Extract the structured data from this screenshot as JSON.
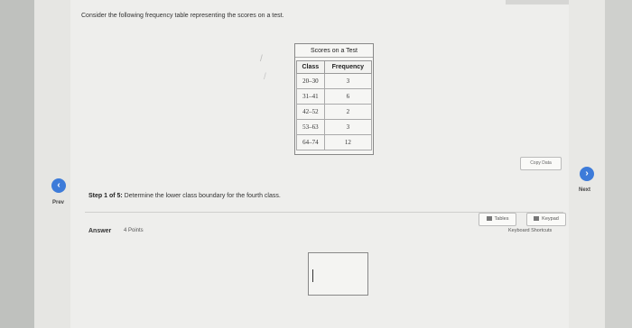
{
  "question": {
    "text": "Consider the following frequency table representing the scores on a test."
  },
  "table": {
    "title": "Scores on a Test",
    "headers": [
      "Class",
      "Frequency"
    ],
    "rows": [
      [
        "20–30",
        "3"
      ],
      [
        "31–41",
        "6"
      ],
      [
        "42–52",
        "2"
      ],
      [
        "53–63",
        "3"
      ],
      [
        "64–74",
        "12"
      ]
    ]
  },
  "nav": {
    "prev_label": "Prev",
    "next_label": "Next",
    "prev_icon": "chevron-left-icon",
    "next_icon": "chevron-right-icon"
  },
  "step": {
    "prefix": "Step 1 of 5:",
    "text": " Determine the lower class boundary for the fourth class."
  },
  "buttons": {
    "copy_data": "Copy Data",
    "tables": "Tables",
    "keypad": "Keypad",
    "shortcuts": "Keyboard Shortcuts"
  },
  "answer": {
    "label": "Answer",
    "points": "4 Points",
    "value": ""
  },
  "colors": {
    "accent": "#3d7bd9"
  }
}
